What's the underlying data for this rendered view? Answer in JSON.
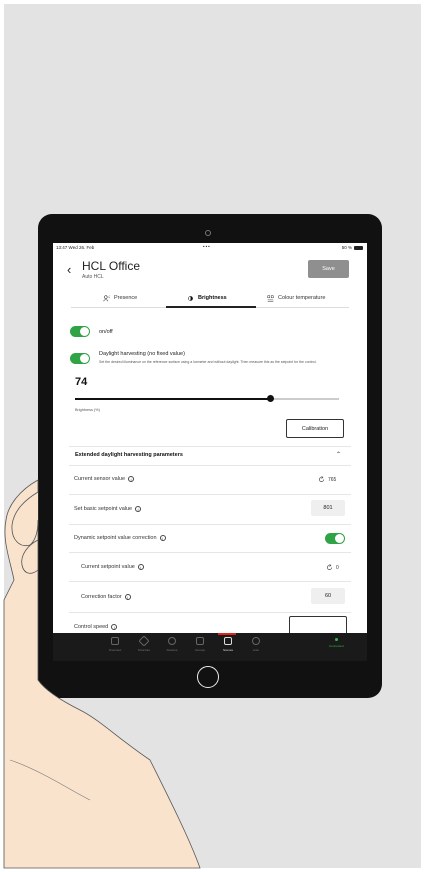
{
  "status_bar": {
    "time": "13:47",
    "date": "Wed 26. Feb",
    "dots": "•••",
    "battery": "50 %"
  },
  "header": {
    "back_icon": "chevron-left-icon",
    "title": "HCL Office",
    "subtitle": "Auto HCL",
    "save_label": "Save"
  },
  "tabs": [
    {
      "label": "Presence",
      "icon": "presence-icon"
    },
    {
      "label": "Brightness",
      "icon": "brightness-icon",
      "active": true
    },
    {
      "label": "Colour temperature",
      "icon": "colour-temperature-icon"
    }
  ],
  "onoff": {
    "label": "on/off",
    "on": true
  },
  "daylight": {
    "label": "Daylight harvesting (no fixed value)",
    "on": true,
    "description": "Set the desired illuminance on the reference surface using a luxmeter and without daylight. Then measure this as the setpoint for the control."
  },
  "brightness": {
    "value": "74",
    "fraction": 0.74,
    "label": "Brightness (%)"
  },
  "calibration_label": "Calibration",
  "extended": {
    "title": "Extended daylight harvesting parameters",
    "current_sensor": {
      "label": "Current sensor value",
      "value": "765"
    },
    "basic_setpoint": {
      "label": "Set basic setpoint value",
      "value": "801"
    },
    "dynamic_correction": {
      "label": "Dynamic setpoint value correction",
      "on": true
    },
    "current_setpoint": {
      "label": "Current setpoint value",
      "value": "0"
    },
    "correction_factor": {
      "label": "Correction factor",
      "value": "60"
    },
    "control_speed": {
      "label": "Control speed"
    }
  },
  "nav": [
    {
      "label": "Overview",
      "icon": "overview-icon"
    },
    {
      "label": "Structure",
      "icon": "structure-icon"
    },
    {
      "label": "Devices",
      "icon": "devices-icon"
    },
    {
      "label": "Groups",
      "icon": "groups-icon"
    },
    {
      "label": "Scenes",
      "icon": "scenes-icon",
      "active": true
    },
    {
      "label": "Auto",
      "icon": "auto-icon"
    }
  ],
  "connection": {
    "label": "Connected",
    "color": "#3ab54a"
  },
  "colors": {
    "toggle_on": "#2fa345",
    "accent_red": "#e2231a",
    "background": "#e3e3e3"
  }
}
